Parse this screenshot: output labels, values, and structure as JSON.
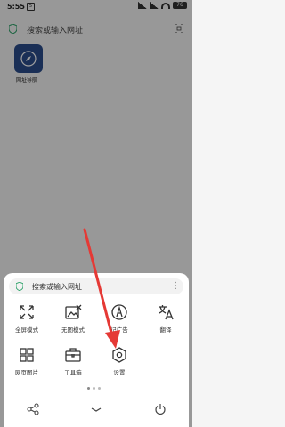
{
  "status_bar": {
    "time": "5:55",
    "sim_badge": "5",
    "battery": "76"
  },
  "top_search": {
    "placeholder": "搜索或输入网址"
  },
  "shortcuts": [
    {
      "label": "网址导航"
    }
  ],
  "sheet": {
    "search_placeholder": "搜索或输入网址",
    "more_label": "⋮",
    "items": [
      {
        "label": "全屏模式",
        "icon": "fullscreen-icon"
      },
      {
        "label": "无图模式",
        "icon": "no-image-icon"
      },
      {
        "label": "记广告",
        "icon": "ad-block-icon"
      },
      {
        "label": "翻译",
        "icon": "translate-icon"
      },
      {
        "label": "网页图片",
        "icon": "web-images-icon"
      },
      {
        "label": "工具箱",
        "icon": "toolbox-icon"
      },
      {
        "label": "设置",
        "icon": "settings-icon"
      }
    ],
    "page_indicator": {
      "pages": 3,
      "current": 1
    }
  },
  "colors": {
    "accent_arrow": "#e53935",
    "shortcut_tile": "#2b4d8c",
    "shield": "#2fa36b"
  }
}
